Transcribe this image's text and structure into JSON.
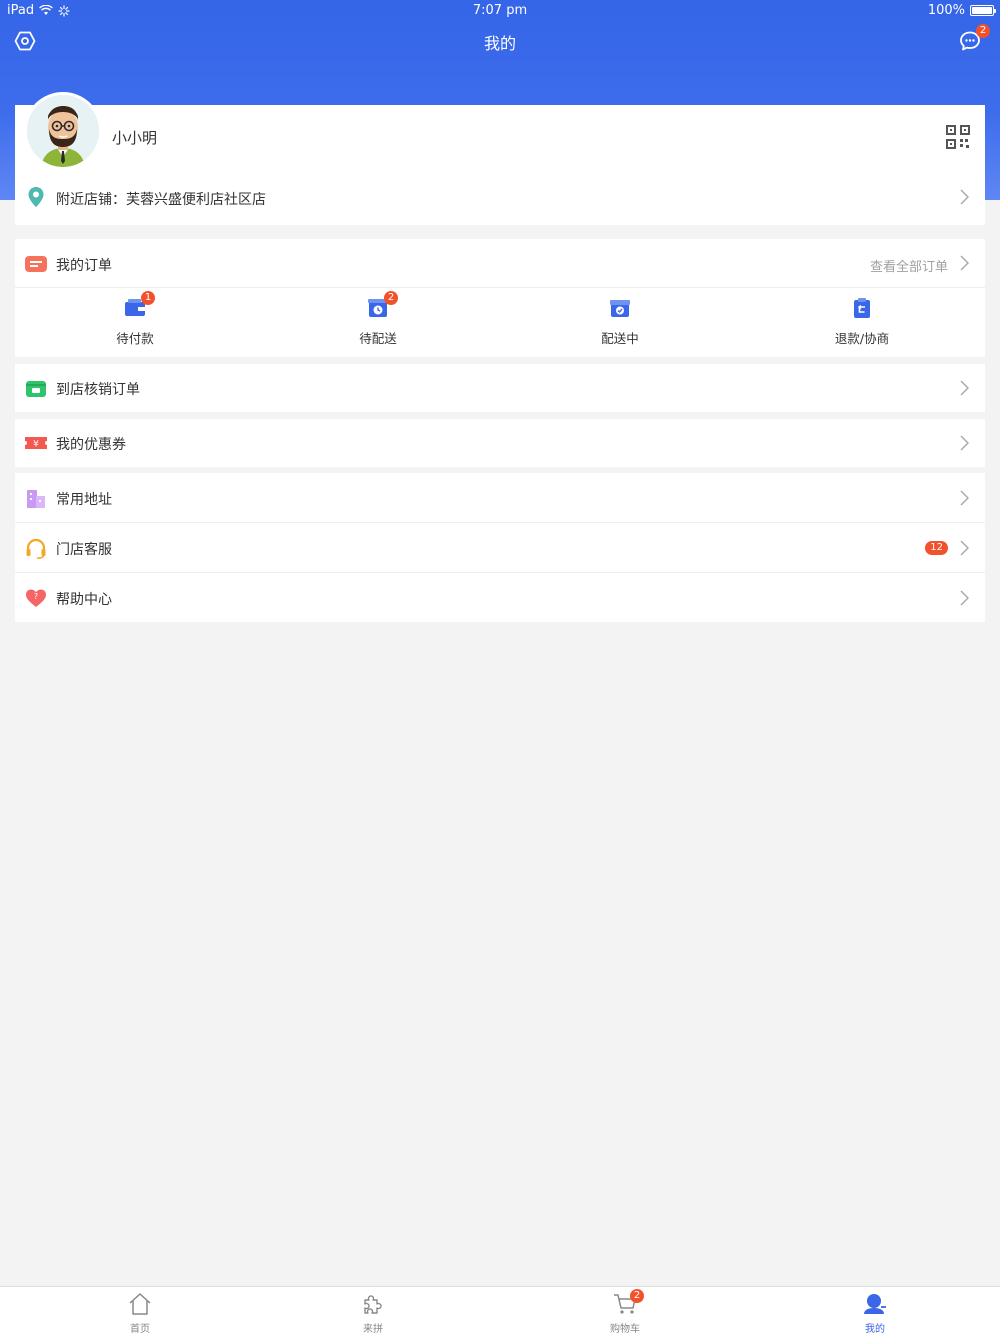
{
  "status_bar": {
    "device": "iPad",
    "time": "7:07 pm",
    "battery": "100%"
  },
  "nav": {
    "title": "我的",
    "message_badge": "2"
  },
  "profile": {
    "username": "小小明",
    "store_label": "附近店铺：芙蓉兴盛便利店社区店"
  },
  "orders": {
    "title": "我的订单",
    "view_all": "查看全部订单",
    "items": [
      {
        "label": "待付款",
        "badge": "1",
        "icon": "wallet-icon"
      },
      {
        "label": "待配送",
        "badge": "2",
        "icon": "clock-box-icon"
      },
      {
        "label": "配送中",
        "badge": "",
        "icon": "delivery-box-icon"
      },
      {
        "label": "退款/协商",
        "badge": "",
        "icon": "refund-clipboard-icon"
      }
    ]
  },
  "store_orders": {
    "label": "到店核销订单"
  },
  "coupons": {
    "label": "我的优惠券"
  },
  "menu": [
    {
      "label": "常用地址",
      "icon": "address-building-icon"
    },
    {
      "label": "门店客服",
      "icon": "headset-icon",
      "badge": "12"
    },
    {
      "label": "帮助中心",
      "icon": "heart-help-icon"
    }
  ],
  "tabbar": [
    {
      "label": "首页",
      "icon": "home-icon"
    },
    {
      "label": "来拼",
      "icon": "puzzle-icon"
    },
    {
      "label": "购物车",
      "icon": "cart-icon",
      "badge": "2"
    },
    {
      "label": "我的",
      "icon": "user-icon",
      "active": true
    }
  ],
  "colors": {
    "primary": "#3a66e8",
    "badge": "#f2522b",
    "background": "#f3f3f3"
  }
}
